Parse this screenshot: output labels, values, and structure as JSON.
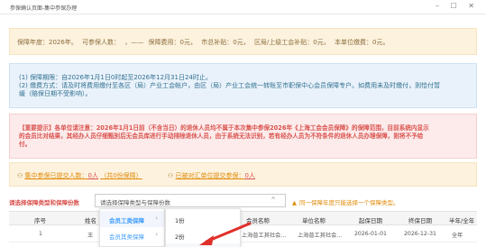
{
  "window": {
    "title": "参保确认页面-集中参保办理",
    "controls": "– ☐ ✕"
  },
  "year_panel": {
    "year": "保障年度：2026年。",
    "count": "可参保人数：",
    "count_value": "，——",
    "fee": "保障费用：0元，",
    "city_subsidy": "市总补贴：0元，",
    "district_subsidy": "区局/上级工会补贴：0元，",
    "payment": "本单位缴费：0元。"
  },
  "info_panel": {
    "line1": "(1) 保障期限：自2026年1月1日0时起至2026年12月31日24时止。",
    "line2": "(2) 缴费方式：请及时将费用缴付至各区（局）产业工会帐户，由区（局）产业工会统一转账至市职保中心会员保障专户。如费用未及时缴付，则恰付暂",
    "line3": "缓（赔保日期不受影响）。"
  },
  "warning_panel": {
    "line1": "【重要提示】各单位请注意：2026年1月1日前（不含当日）的退休人员均不属于本次集中参保2026年《上海工会会员保障》的保障范围，目前系统内显示",
    "line2": "的会员比对结果，其经办人员仔细甄别后无会员库进行手动排除退休人员，由于系统无法识别，若有经办人员为不符条件的退休人员办理保障，则将不予给",
    "line3": "付。"
  },
  "summary_panel": {
    "submitted_prefix": "集中参保已提交人数：",
    "submitted_value": "0人",
    "submitted_paren": "（共0份保障）",
    "paid_prefix": "已被对汇单位提交参保：",
    "paid_value": "0人"
  },
  "select_row": {
    "label": "请选择保障类型和保障份数",
    "value": "请选择保障类型与保障份数",
    "caret": "^",
    "tip": "同一保障年度只能选择一个保障类型。"
  },
  "table": {
    "columns": [
      "序号",
      "姓名",
      "",
      "会员名称",
      "单位名称",
      "起保日期",
      "终保日期",
      "半年/全年"
    ],
    "rows": [
      [
        "1",
        "王",
        "",
        "上海普工其社会...",
        "上海普工其社会...",
        "2026-01-01",
        "2026-12-31",
        "全年"
      ]
    ]
  },
  "cascader": {
    "level1": [
      {
        "label": "会员工类保障",
        "chevron": "›",
        "active": true
      },
      {
        "label": "会员其类保障",
        "chevron": "›",
        "active": false
      }
    ],
    "level2": [
      {
        "label": "1份"
      },
      {
        "label": "2份"
      },
      {
        "label": ""
      }
    ]
  },
  "colors": {
    "accent": "#409eff",
    "warning": "#d9534f",
    "notice": "#e08c0b",
    "arrow": "#e0302a"
  },
  "icons": {
    "warning": "warning-triangle-icon",
    "person": "person-icon",
    "chevron": "chevron-right-icon"
  }
}
